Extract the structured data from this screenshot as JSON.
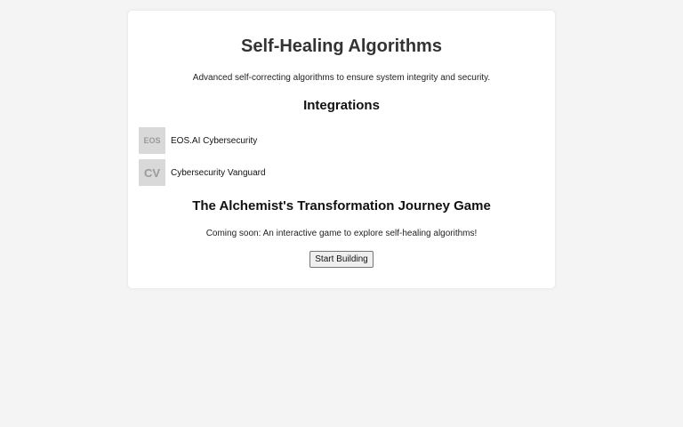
{
  "header": {
    "title": "Self-Healing Algorithms",
    "description": "Advanced self-correcting algorithms to ensure system integrity and security."
  },
  "integrations": {
    "title": "Integrations",
    "items": [
      {
        "logo_text": "EOS",
        "name": "EOS.AI Cybersecurity"
      },
      {
        "logo_text": "CV",
        "name": "Cybersecurity Vanguard"
      }
    ]
  },
  "game": {
    "title": "The Alchemist's Transformation Journey Game",
    "description": "Coming soon: An interactive game to explore self-healing algorithms!",
    "button_label": "Start Building"
  },
  "colors": {
    "background": "#f4f4f4",
    "card": "#ffffff",
    "logo_bg": "#d9d9d9",
    "logo_text": "#9a9a9a"
  }
}
